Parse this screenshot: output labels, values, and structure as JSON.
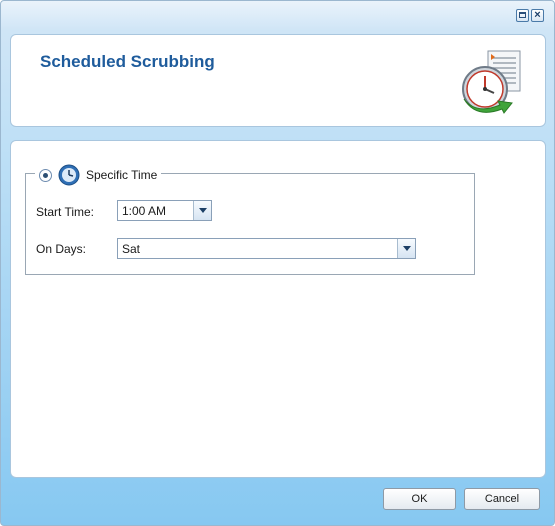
{
  "window": {
    "close_glyph": "×"
  },
  "header": {
    "title": "Scheduled Scrubbing",
    "icon": "scheduled-clock-document-icon"
  },
  "schedule": {
    "mode_label": "Specific Time",
    "mode_selected": true,
    "start_time": {
      "label": "Start Time:",
      "value": "1:00 AM"
    },
    "on_days": {
      "label": "On Days:",
      "value": "Sat"
    }
  },
  "footer": {
    "ok_label": "OK",
    "cancel_label": "Cancel"
  }
}
